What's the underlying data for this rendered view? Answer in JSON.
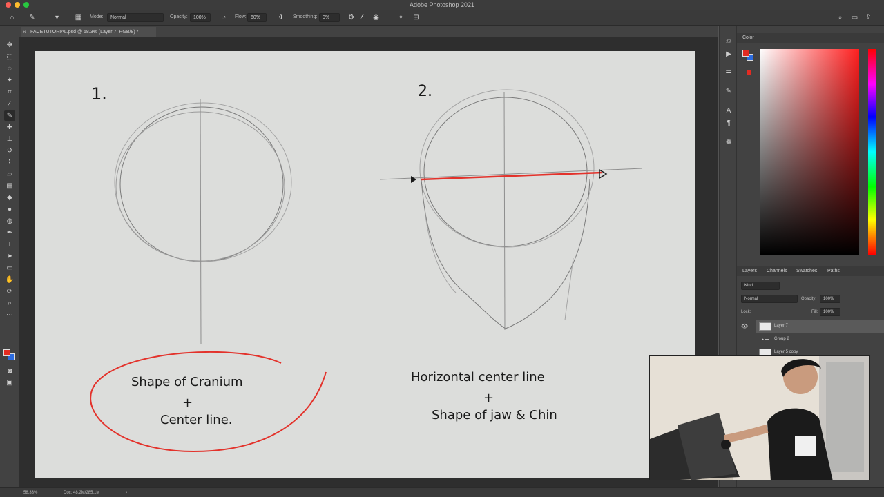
{
  "app": {
    "title": "Adobe Photoshop 2021"
  },
  "options_bar": {
    "mode_label": "Mode:",
    "mode_value": "Normal",
    "opacity_label": "Opacity:",
    "opacity_value": "100%",
    "flow_label": "Flow:",
    "flow_value": "60%",
    "smoothing_label": "Smoothing:",
    "smoothing_value": "0%"
  },
  "document": {
    "tab_title": "FACETUTORIAL.psd @ 58.3% (Layer 7, RGB/8) *"
  },
  "canvas": {
    "drawing1": {
      "number": "1.",
      "caption_line1": "Shape of Cranium",
      "caption_plus": "+",
      "caption_line2": "Center line."
    },
    "drawing2": {
      "number": "2.",
      "caption_line1": "Horizontal center line",
      "caption_plus": "+",
      "caption_line2": "Shape of jaw & Chin"
    },
    "accent_color": "#e3322b"
  },
  "panels": {
    "color": {
      "tab": "Color"
    },
    "layers": {
      "tabs": [
        "Layers",
        "Channels",
        "Swatches",
        "Paths"
      ],
      "filter_kind": "Kind",
      "blend_mode": "Normal",
      "opacity_label": "Opacity:",
      "opacity_value": "100%",
      "lock_label": "Lock:",
      "fill_label": "Fill:",
      "fill_value": "100%",
      "items": [
        {
          "name": "Layer 7",
          "selected": true
        },
        {
          "name": "Group 2",
          "selected": false
        },
        {
          "name": "Layer 5 copy",
          "selected": false
        }
      ]
    }
  },
  "status_bar": {
    "zoom": "58.33%",
    "doc_size": "Doc: 48.2M/285.1M"
  }
}
